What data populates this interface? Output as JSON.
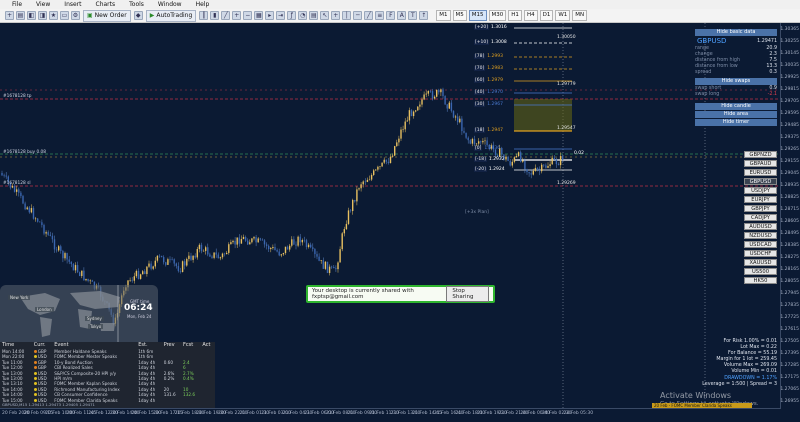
{
  "menu": [
    "File",
    "View",
    "Insert",
    "Charts",
    "Tools",
    "Window",
    "Help"
  ],
  "toolbar": {
    "new_order": "New Order",
    "autotrading": "AutoTrading",
    "timeframes": [
      "M1",
      "M5",
      "M15",
      "M30",
      "H1",
      "H4",
      "D1",
      "W1",
      "MN"
    ],
    "active_timeframe": "M15"
  },
  "price_axis": [
    "1.30365",
    "1.30255",
    "1.30145",
    "1.30035",
    "1.29925",
    "1.29815",
    "1.29705",
    "1.29595",
    "1.29485",
    "1.29375",
    "1.29265",
    "1.29155",
    "1.29045",
    "1.28935",
    "1.28825",
    "1.28715",
    "1.28605",
    "1.28495",
    "1.28385",
    "1.28275",
    "1.28165",
    "1.28055",
    "1.27945",
    "1.27835",
    "1.27725",
    "1.27615",
    "1.27505",
    "1.27395",
    "1.27285",
    "1.27175",
    "1.27065",
    "1.26955"
  ],
  "time_axis": [
    "20 Feb 2020",
    "20 Feb 09:15",
    "20 Feb 10:00",
    "20 Feb 11:45",
    "20 Feb 12:30",
    "20 Feb 14:00",
    "20 Feb 15:30",
    "20 Feb 17:15",
    "20 Feb 18:30",
    "20 Feb 19:30",
    "20 Feb 22:00",
    "21 Feb 01:30",
    "21 Feb 03:00",
    "21 Feb 04:30",
    "21 Feb 06:00",
    "21 Feb 08:00",
    "21 Feb 09:00",
    "21 Feb 11:30",
    "21 Feb 13:00",
    "21 Feb 14:45",
    "21 Feb 16:40",
    "21 Feb 18:00",
    "21 Feb 19:20",
    "21 Feb 21:00",
    "24 Feb 00:40",
    "24 Feb 02:30",
    "24 Feb 05:30"
  ],
  "levels": [
    {
      "label": "[+20]",
      "price": "1.3016"
    },
    {
      "label": "[+10]",
      "price": "1.3008"
    },
    {
      "label": "[78]",
      "price": "1.2993"
    },
    {
      "label": "[70]",
      "price": "1.2983"
    },
    {
      "label": "[60]",
      "price": "1.2979"
    },
    {
      "label": "[40]",
      "price": "1.2970"
    },
    {
      "label": "[30]",
      "price": "1.2967"
    },
    {
      "label": "[18]",
      "price": "1.2947"
    },
    {
      "label": "[0]",
      "price": "1.2936"
    },
    {
      "label": "[-18]",
      "price": "1.2932"
    },
    {
      "label": "[-20]",
      "price": "1.2924"
    }
  ],
  "level_right_prices": [
    "1.30050",
    "1.29779",
    "1.29547",
    "1.29269"
  ],
  "level_bottom_note": "[+3x Plan]",
  "price_tag": "0.02",
  "left_labels": [
    "#1678128 tp",
    "#1678128 buy 0.08",
    "#1678128 sl"
  ],
  "right_panel": {
    "hide_basic": "Hide basic data",
    "symbol": "GBPUSD",
    "symbol_price": "1.29471",
    "rows": [
      {
        "k": "range",
        "v": "20.9"
      },
      {
        "k": "change",
        "v": "2.3"
      },
      {
        "k": "distance from high",
        "v": "7.5"
      },
      {
        "k": "distance from low",
        "v": "13.3"
      },
      {
        "k": "spread",
        "v": "0.3"
      }
    ],
    "hide_swaps": "Hide swaps",
    "swap_rows": [
      {
        "k": "swap short",
        "v": "0.9"
      },
      {
        "k": "swap long",
        "v": "-2.1"
      }
    ],
    "hide_candle": "Hide candle",
    "hide_area": "Hide area",
    "hide_timer": "Hide timer"
  },
  "pairs": [
    "GBPNZD",
    "GBPAUD",
    "EURUSD",
    "GBPUSD",
    "USDJPY",
    "EURJPY",
    "GBPJPY",
    "CADJPY",
    "AUDUSD",
    "NZDUSD",
    "USDCAD",
    "USDCHF",
    "XAUUSD",
    "US500",
    "HK50"
  ],
  "selected_pair": "GBPUSD",
  "risk": [
    "For Risk 1.00% = 0.01",
    "Lot Max = 0.22",
    "For Balance = 55.19",
    "Margin for 1 lot = 259.45",
    "Volume Max = 269.09",
    "Volume Min = 0.01",
    "DRAWDOWN = 1.17%",
    "Leverage = 1:500 | Spread = 3"
  ],
  "share": {
    "text": "Your desktop is currently shared with fxptsp@gmail.com",
    "button": "Stop Sharing"
  },
  "clock": {
    "time": "06:24",
    "gmt": "GMT time",
    "date": "Mon, Feb 24",
    "cities": [
      "New York",
      "London",
      "Sydney",
      "Tokyo"
    ]
  },
  "news": {
    "headers": [
      "Time",
      "Curr.",
      "Event",
      "Est.",
      "Prev",
      "Fcst",
      "Act"
    ],
    "rows": [
      [
        "Mon 14:00",
        "GBP",
        "Member Haldane Speaks",
        "1th 6m",
        "",
        "",
        ""
      ],
      [
        "Mon 22:00",
        "USD",
        "FOMC Member Mester Speaks",
        "1th 6m",
        "",
        "",
        ""
      ],
      [
        "Tue 11:00",
        "GBP",
        "10-y Bond Auction",
        "1day 4h",
        "0.60",
        "2.4",
        ""
      ],
      [
        "Tue 12:00",
        "GBP",
        "CBI Realized Sales",
        "1day 4h",
        "",
        "6",
        ""
      ],
      [
        "Tue 13:00",
        "USD",
        "S&P/CS Composite-20 HPI y/y",
        "1day 4h",
        "2.6%",
        "2.7%",
        ""
      ],
      [
        "Tue 13:00",
        "USD",
        "HPI m/m",
        "1day 4h",
        "0.2%",
        "0.4%",
        ""
      ],
      [
        "Tue 13:10",
        "USD",
        "FOMC Member Kaplan Speaks",
        "1day 4h",
        "",
        "",
        ""
      ],
      [
        "Tue 14:00",
        "USD",
        "Richmond Manufacturing Index",
        "1day 4h",
        "20",
        "10",
        ""
      ],
      [
        "Tue 14:00",
        "USD",
        "CB Consumer Confidence",
        "1day 4h",
        "131.6",
        "132.6",
        ""
      ],
      [
        "Tue 15:00",
        "USD",
        "FOMC Member Clarida Speaks",
        "1day 4h",
        "",
        "",
        ""
      ]
    ]
  },
  "status": "GBPUSD,M15 1.29413 1.29473 1.29405 1.29471",
  "activate": {
    "title": "Activate Windows",
    "sub": "Go to Settings to activate Windows."
  },
  "ticker": "20 Feb - FOMC Member Clarida Speaks"
}
